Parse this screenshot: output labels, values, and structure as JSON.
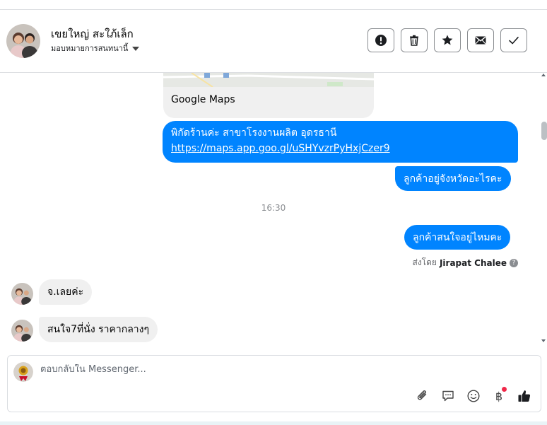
{
  "header": {
    "contact_name": "เขยใหญ่ สะใภ้เล็ก",
    "assign_label": "มอบหมายการสนทนานี้",
    "actions": [
      {
        "name": "spam",
        "icon": "exclamation-icon"
      },
      {
        "name": "delete",
        "icon": "trash-icon"
      },
      {
        "name": "star",
        "icon": "star-icon"
      },
      {
        "name": "unread",
        "icon": "envelope-icon"
      },
      {
        "name": "done",
        "icon": "check-icon"
      }
    ]
  },
  "messages": {
    "map_card_title": "Google Maps",
    "out1_text": "พิกัดร้านค่ะ สาขาโรงงานผลิต อุดรธานี",
    "out1_link": "https://maps.app.goo.gl/uSHYvzrPyHxjCzer9",
    "out2_text": "ลูกค้าอยู่จังหวัดอะไรคะ",
    "timestamp": "16:30",
    "out3_text": "ลูกค้าสนใจอยู่ไหมคะ",
    "sent_by_prefix": "ส่งโดย",
    "sent_by_name": "Jirapat Chalee",
    "help_glyph": "?",
    "in1_text": "จ.เลยค่ะ",
    "in2_text": "สนใจ7ที่นั่ง ราคากลางๆ"
  },
  "composer": {
    "placeholder": "ตอบกลับใน Messenger...",
    "baht_glyph": "฿",
    "tools": [
      "paperclip-icon",
      "speech-bubble-icon",
      "smiley-icon",
      "baht-icon",
      "thumbs-up-icon"
    ]
  },
  "colors": {
    "outgoing_bubble": "#0084ff",
    "incoming_bubble": "#f0f0f0",
    "like_button": "#1c1e21"
  }
}
